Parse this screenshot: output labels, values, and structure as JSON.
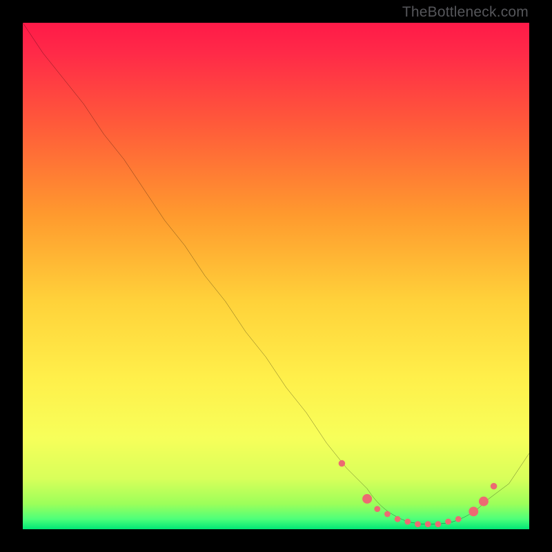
{
  "watermark": "TheBottleneck.com",
  "chart_data": {
    "type": "line",
    "title": "",
    "xlabel": "",
    "ylabel": "",
    "xlim": [
      0,
      100
    ],
    "ylim": [
      0,
      100
    ],
    "grid": false,
    "legend": false,
    "background_gradient": {
      "top": "#ff1a48",
      "upper_mid": "#ff8a2a",
      "mid": "#ffe53b",
      "lower_mid": "#f9ff5a",
      "near_bottom": "#b6ff5a",
      "bottom": "#00e676"
    },
    "series": [
      {
        "name": "bottleneck-curve",
        "color": "#000000",
        "x": [
          0,
          4,
          8,
          12,
          16,
          20,
          24,
          28,
          32,
          36,
          40,
          44,
          48,
          52,
          56,
          60,
          64,
          68,
          72,
          76,
          80,
          84,
          88,
          92,
          96,
          100
        ],
        "y": [
          100,
          94,
          89,
          84,
          78,
          73,
          67,
          61,
          56,
          50,
          45,
          39,
          34,
          28,
          23,
          17,
          12,
          8,
          4,
          2,
          1,
          1,
          2,
          4,
          9,
          15
        ]
      }
    ],
    "markers": {
      "name": "highlighted-points",
      "color": "#ec6b72",
      "radius_small": 4,
      "radius_large": 6,
      "points": [
        {
          "x": 63,
          "y": 13,
          "r": 4
        },
        {
          "x": 68,
          "y": 6,
          "r": 6
        },
        {
          "x": 70,
          "y": 4,
          "r": 4
        },
        {
          "x": 72,
          "y": 3,
          "r": 4
        },
        {
          "x": 74,
          "y": 2,
          "r": 4
        },
        {
          "x": 76,
          "y": 2,
          "r": 4
        },
        {
          "x": 78,
          "y": 1,
          "r": 4
        },
        {
          "x": 80,
          "y": 1,
          "r": 4
        },
        {
          "x": 82,
          "y": 1,
          "r": 4
        },
        {
          "x": 84,
          "y": 2,
          "r": 4
        },
        {
          "x": 86,
          "y": 2,
          "r": 4
        },
        {
          "x": 89,
          "y": 4,
          "r": 6
        },
        {
          "x": 91,
          "y": 6,
          "r": 6
        },
        {
          "x": 93,
          "y": 9,
          "r": 4
        }
      ]
    }
  }
}
